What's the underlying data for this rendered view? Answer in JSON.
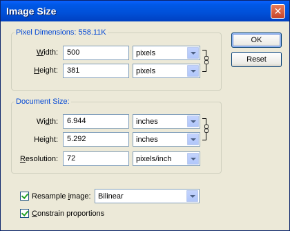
{
  "window": {
    "title": "Image Size",
    "close_glyph": "✕"
  },
  "pixel_dimensions": {
    "label": "Pixel Dimensions:  558.11K",
    "width": {
      "label_pre": "",
      "label_u": "W",
      "label_post": "idth:",
      "value": "500",
      "unit": "pixels"
    },
    "height": {
      "label_pre": "",
      "label_u": "H",
      "label_post": "eight:",
      "value": "381",
      "unit": "pixels"
    }
  },
  "document_size": {
    "label": "Document Size:",
    "width": {
      "label_pre": "Wi",
      "label_u": "d",
      "label_post": "th:",
      "value": "6.944",
      "unit": "inches"
    },
    "height": {
      "label_pre": "Hei",
      "label_u": "g",
      "label_post": "ht:",
      "value": "5.292",
      "unit": "inches"
    },
    "resolution": {
      "label_pre": "",
      "label_u": "R",
      "label_post": "esolution:",
      "value": "72",
      "unit": "pixels/inch"
    }
  },
  "buttons": {
    "ok": "OK",
    "reset": "Reset"
  },
  "options": {
    "resample": {
      "label_pre": "Resample ",
      "label_u": "i",
      "label_post": "mage:",
      "checked": true,
      "method": "Bilinear"
    },
    "constrain": {
      "label_pre": "",
      "label_u": "C",
      "label_post": "onstrain proportions",
      "checked": true
    }
  },
  "colors": {
    "title_bar": "#0054e3",
    "group_label": "#0046d5",
    "dialog_bg": "#ece9d8"
  }
}
